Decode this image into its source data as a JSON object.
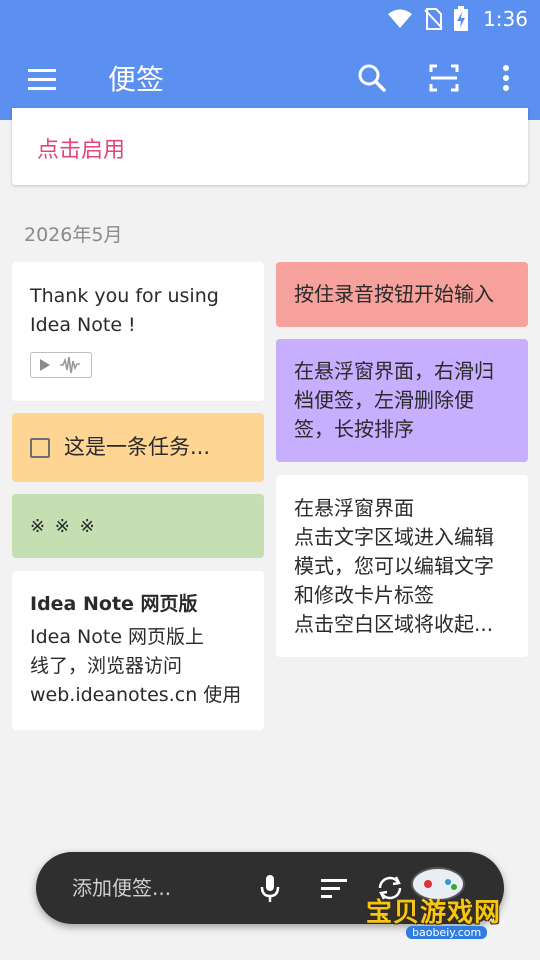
{
  "status_bar": {
    "time": "1:36"
  },
  "toolbar": {
    "title": "便签"
  },
  "enable_card": {
    "link": "点击启用"
  },
  "section": {
    "date": "2026年5月"
  },
  "notes": {
    "welcome": {
      "text": "Thank you for using\nIdea Note !"
    },
    "task": {
      "text": "这是一条任务..."
    },
    "stars": {
      "text": "※ ※ ※"
    },
    "web": {
      "title": "Idea Note 网页版",
      "text": "Idea Note 网页版上\n线了，浏览器访问\nweb.ideanotes.cn 使用"
    },
    "record": {
      "text": "按住录音按钮开始输入"
    },
    "swipe": {
      "text": "在悬浮窗界面，右滑归\n档便签，左滑删除便\n签，长按排序"
    },
    "edit": {
      "text": "在悬浮窗界面\n点击文字区域进入编辑\n模式，您可以编辑文字\n和修改卡片标签\n点击空白区域将收起..."
    }
  },
  "bottom_bar": {
    "placeholder": "添加便签..."
  },
  "watermark": {
    "brand": "宝贝游戏网",
    "url": "baobeiy.com"
  },
  "colors": {
    "app_bar": "#5b8ff0",
    "accent_link": "#e0457b",
    "note_orange": "#ffd593",
    "note_green": "#c5dfb3",
    "note_red": "#f7a19c",
    "note_purple": "#c8aefe"
  },
  "icons": [
    "wifi-icon",
    "no-sim-icon",
    "battery-charging-icon",
    "menu-icon",
    "search-icon",
    "scan-icon",
    "more-vert-icon",
    "play-icon",
    "waveform-icon",
    "checkbox-icon",
    "mic-icon",
    "sort-icon",
    "sync-icon"
  ]
}
